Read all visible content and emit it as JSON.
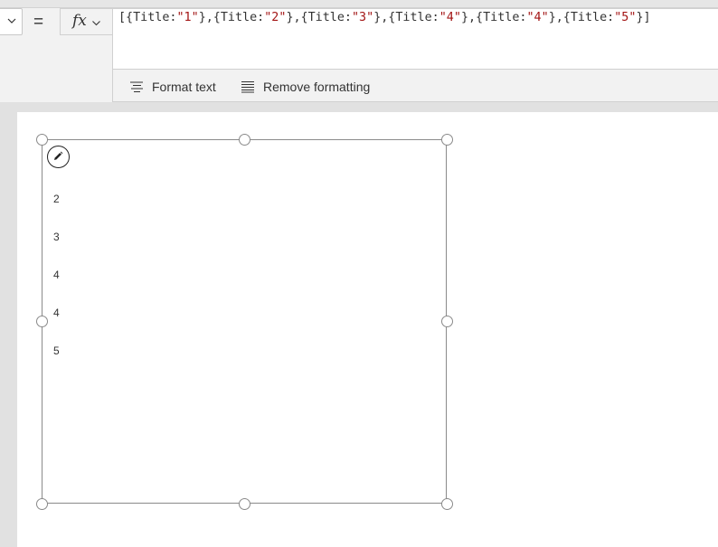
{
  "formula_bar": {
    "property_dropdown_value": "",
    "equals": "=",
    "fx_label": "fx",
    "formula_parts": [
      {
        "text": "[{Title:",
        "kind": "plain"
      },
      {
        "text": "\"1\"",
        "kind": "string"
      },
      {
        "text": "},{Title:",
        "kind": "plain"
      },
      {
        "text": "\"2\"",
        "kind": "string"
      },
      {
        "text": "},{Title:",
        "kind": "plain"
      },
      {
        "text": "\"3\"",
        "kind": "string"
      },
      {
        "text": "},{Title:",
        "kind": "plain"
      },
      {
        "text": "\"4\"",
        "kind": "string"
      },
      {
        "text": "},{Title:",
        "kind": "plain"
      },
      {
        "text": "\"4\"",
        "kind": "string"
      },
      {
        "text": "},{Title:",
        "kind": "plain"
      },
      {
        "text": "\"5\"",
        "kind": "string"
      },
      {
        "text": "}]",
        "kind": "plain"
      }
    ],
    "string_color": "#a31515"
  },
  "format_toolbar": {
    "format_text_label": "Format text",
    "remove_formatting_label": "Remove formatting"
  },
  "gallery": {
    "items": [
      "2",
      "3",
      "4",
      "4",
      "5"
    ],
    "edit_icon": "pencil-icon"
  }
}
